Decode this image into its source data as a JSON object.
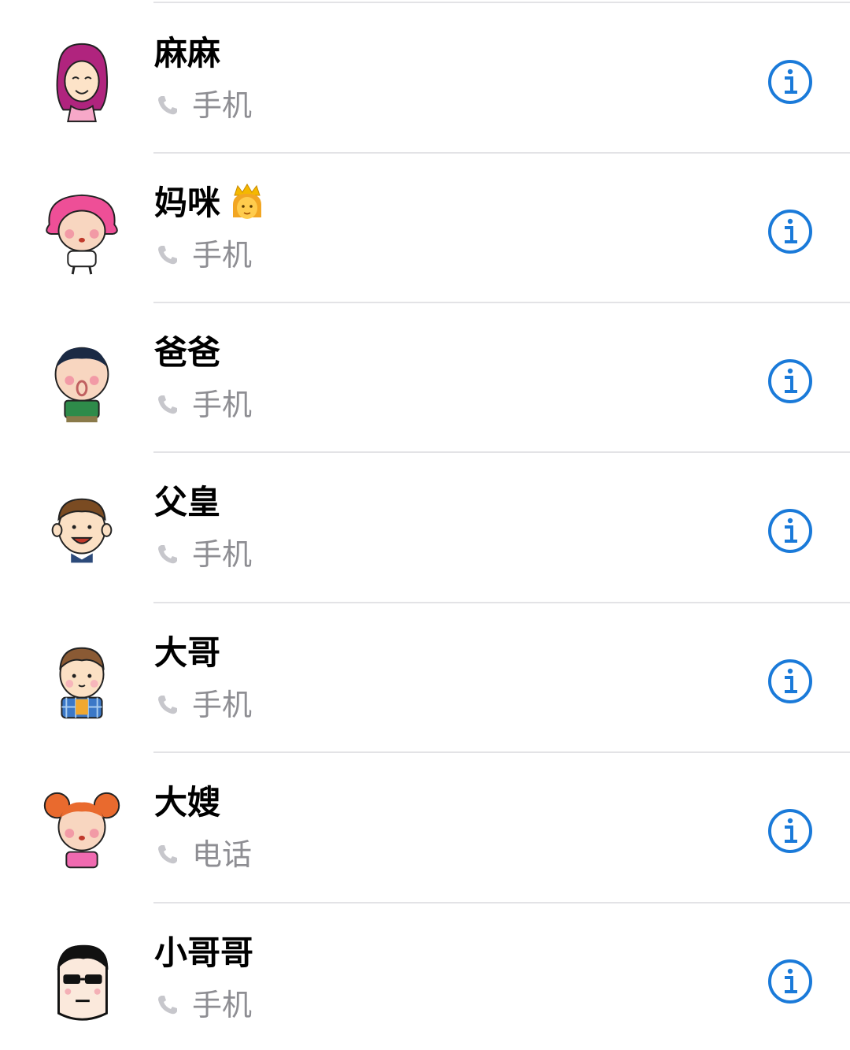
{
  "contacts": [
    {
      "name": "麻麻",
      "label": "手机",
      "avatar": "woman-magenta-hair-avatar"
    },
    {
      "name": "妈咪",
      "label": "手机",
      "avatar": "pink-hair-girl-avatar",
      "emoji": "princess-emoji"
    },
    {
      "name": "爸爸",
      "label": "手机",
      "avatar": "man-green-shirt-avatar"
    },
    {
      "name": "父皇",
      "label": "手机",
      "avatar": "brown-hair-man-avatar"
    },
    {
      "name": "大哥",
      "label": "手机",
      "avatar": "boy-plaid-shirt-avatar"
    },
    {
      "name": "大嫂",
      "label": "电话",
      "avatar": "orange-buns-girl-avatar"
    },
    {
      "name": "小哥哥",
      "label": "手机",
      "avatar": "sunglasses-guy-avatar"
    }
  ],
  "colors": {
    "accent": "#1a7ad9",
    "secondary_text": "#8e8e93",
    "divider": "#e3e3e6"
  },
  "icons": {
    "phone": "phone-icon",
    "info": "info-icon"
  }
}
